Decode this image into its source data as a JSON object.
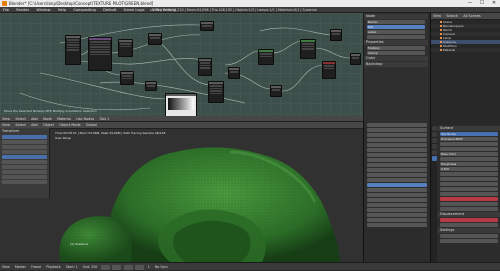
{
  "window": {
    "title": "Blender* [C:\\Users\\lanp\\Desktop\\Concept\\TEXTURE PILOT\\GREEN.blend]",
    "minimize": "—",
    "maximize": "☐",
    "close": "✕"
  },
  "menubar": {
    "items": [
      "File",
      "Render",
      "Window",
      "Help",
      "Compositing",
      "Default",
      "Game Logic",
      "Video Editing",
      "UV Editing",
      "Scripting"
    ],
    "stats": "v2.79 | Verts:54,210 | Faces:54,096 | Tris:108,192 | Objects:1/3 | Lamps:1/1 | Materials:0/1 | Suzanne"
  },
  "node_editor": {
    "header": [
      "View",
      "Select",
      "Add",
      "Node",
      "Material",
      "Use Nodes",
      "Slot 1"
    ],
    "footer_label": "Move the Selected Node(s)  MFK Multiply  Annotation Selection"
  },
  "node_sidebar": {
    "panel_title": "Node",
    "name_label": "Name:",
    "name_value": "Mix",
    "label_label": "Label:",
    "properties_title": "Properties",
    "blend_type": "Multiply",
    "checkbox_clamp": "Clamp",
    "color_title": "Color",
    "backdrop_title": "Backdrop"
  },
  "outliner": {
    "header": [
      "View",
      "Search",
      "All Scenes"
    ],
    "items": [
      "Scene",
      "RenderLayers",
      "World",
      "Camera",
      "Lamp",
      "Suzanne",
      "Modifiers",
      "Material"
    ]
  },
  "viewport": {
    "header": [
      "View",
      "Select",
      "Add",
      "Object",
      "Object Mode",
      "Global"
    ],
    "info_line": "(1) Suzanne",
    "perspective_label": "User Persp",
    "render_info": "Time:00:08.51 | Mem:34.66M, Peak:34.66M | Path Tracing Sample 96/128"
  },
  "tool_panel": {
    "tabs": [
      "Tools",
      "Create",
      "Relations",
      "Shading",
      "Physics"
    ],
    "title": "Transform"
  },
  "properties": {
    "header": [
      "View",
      "Select",
      "Properties"
    ],
    "panel_surface": "Surface",
    "use_nodes_label": "Use Nodes",
    "surface_value": "Principled BSDF",
    "displacement_label": "Displacement",
    "settings_label": "Settings",
    "base_color_label": "Base Color",
    "roughness_label": "Roughness",
    "roughness_value": "0.500"
  },
  "timeline": {
    "items": [
      "View",
      "Marker",
      "Frame",
      "Playback"
    ],
    "start_label": "Start: 1",
    "end_label": "End: 250",
    "current_frame": "1",
    "sync": "No Sync"
  },
  "colors": {
    "accent": "#e87d0d",
    "selection": "#5680c2",
    "node_grid_bg": "#3d4f4b",
    "mesh_green": "#2f7a2f",
    "warning_red": "#b83a44"
  }
}
